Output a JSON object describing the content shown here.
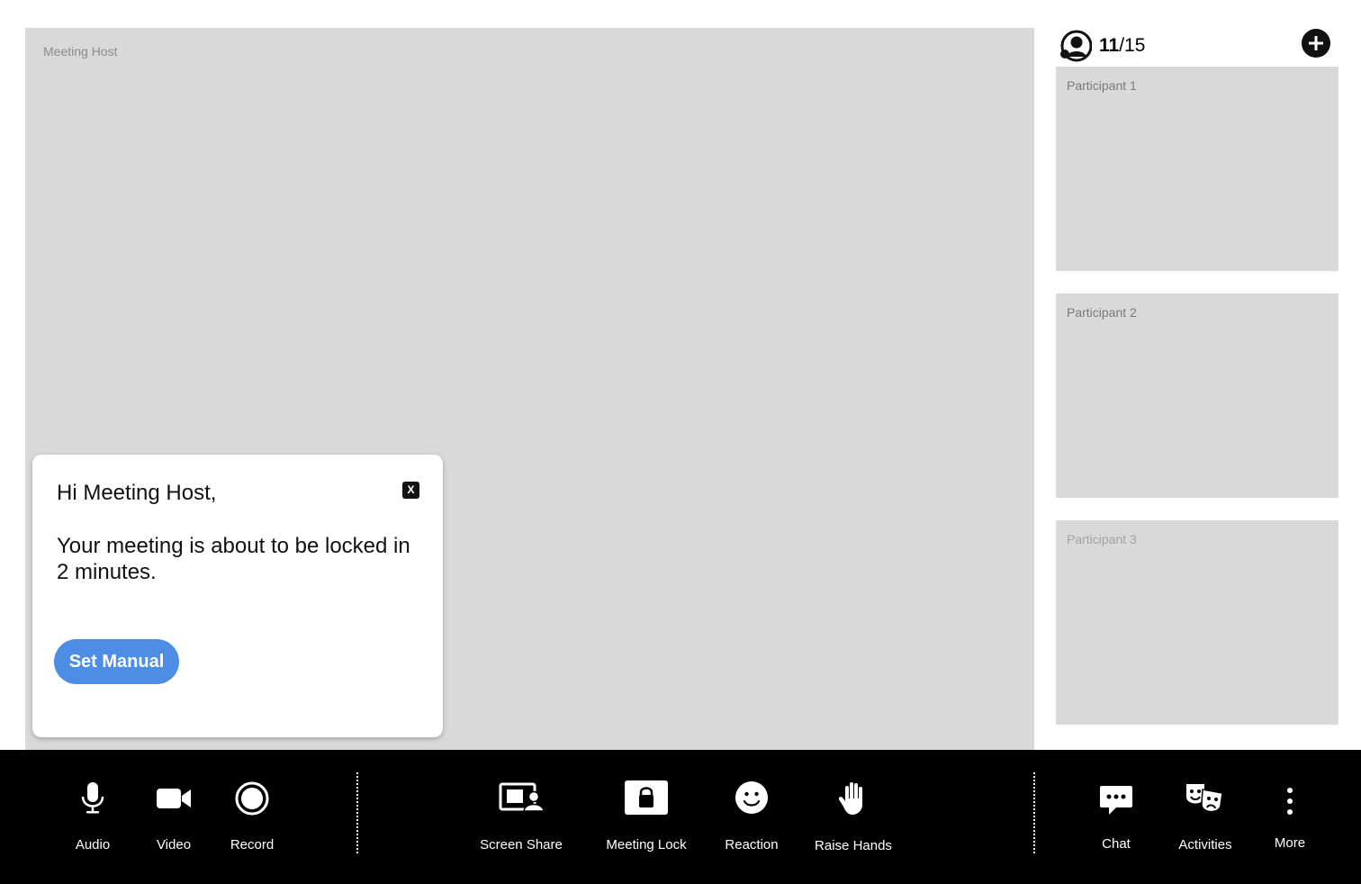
{
  "host": {
    "label": "Meeting Host"
  },
  "participants_header": {
    "count_current": "11",
    "count_total": "/15",
    "people_icon": "participants-icon",
    "add_icon": "plus-circle-icon"
  },
  "participants": [
    {
      "label": "Participant 1"
    },
    {
      "label": "Participant 2"
    },
    {
      "label": "Participant 3"
    }
  ],
  "popup": {
    "greeting": "Hi Meeting Host,",
    "message": "Your meeting is about to be locked in 2 minutes.",
    "close_label": "X",
    "button_label": "Set Manual",
    "button_color": "#4e8de6"
  },
  "toolbar": {
    "audio": {
      "label": "Audio",
      "icon": "microphone-icon"
    },
    "video": {
      "label": "Video",
      "icon": "video-camera-icon"
    },
    "record": {
      "label": "Record",
      "icon": "record-icon"
    },
    "screen_share": {
      "label": "Screen Share",
      "icon": "screen-share-icon"
    },
    "meeting_lock": {
      "label": "Meeting Lock",
      "icon": "lock-icon"
    },
    "reaction": {
      "label": "Reaction",
      "icon": "smiley-icon"
    },
    "raise_hands": {
      "label": "Raise Hands",
      "icon": "hand-icon"
    },
    "chat": {
      "label": "Chat",
      "icon": "chat-bubble-icon"
    },
    "activities": {
      "label": "Activities",
      "icon": "theater-masks-icon"
    },
    "more": {
      "label": "More",
      "icon": "vertical-dots-icon"
    }
  }
}
